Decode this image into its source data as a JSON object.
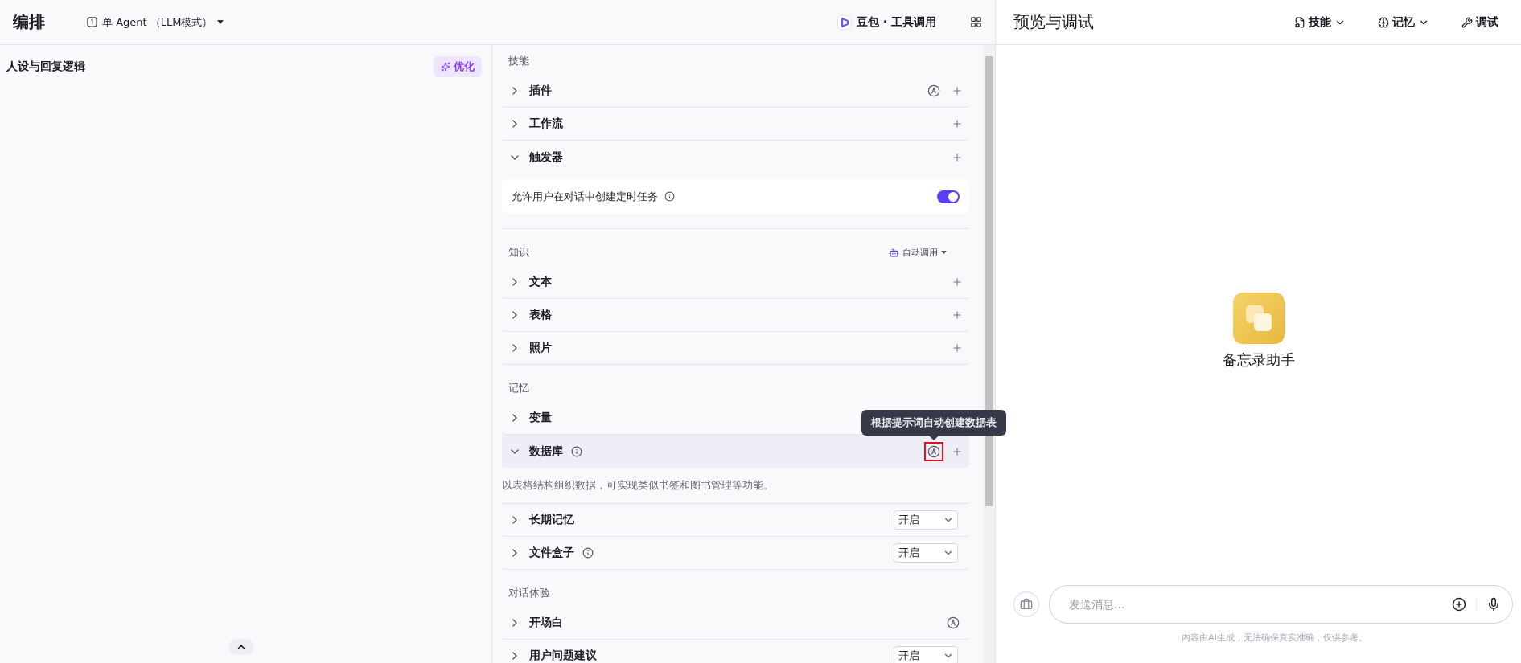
{
  "header": {
    "title": "编排",
    "mode": "单 Agent （LLM模式）",
    "model": "豆包 · 工具调用"
  },
  "persona": {
    "title": "人设与回复逻辑",
    "optimize": "优化"
  },
  "sections": [
    {
      "title": "技能",
      "items": [
        {
          "label": "插件",
          "kind": "add",
          "expanded": false,
          "auto": true
        },
        {
          "label": "工作流",
          "kind": "add",
          "expanded": false
        },
        {
          "label": "触发器",
          "kind": "add",
          "expanded": true,
          "setting": {
            "label": "允许用户在对话中创建定时任务",
            "on": true
          }
        }
      ]
    },
    {
      "title": "知识",
      "action": "自动调用",
      "items": [
        {
          "label": "文本",
          "kind": "add",
          "expanded": false
        },
        {
          "label": "表格",
          "kind": "add",
          "expanded": false
        },
        {
          "label": "照片",
          "kind": "add",
          "expanded": false
        }
      ]
    },
    {
      "title": "记忆",
      "items": [
        {
          "label": "变量",
          "kind": "none",
          "expanded": false
        },
        {
          "label": "数据库",
          "kind": "add",
          "expanded": true,
          "info": true,
          "auto": true,
          "hovered": true,
          "highlighted": true,
          "tooltip": "根据提示词自动创建数据表",
          "description": "以表格结构组织数据，可实现类似书签和图书管理等功能。"
        },
        {
          "label": "长期记忆",
          "kind": "select",
          "expanded": false,
          "value": "开启"
        },
        {
          "label": "文件盒子",
          "kind": "select",
          "expanded": false,
          "info": true,
          "value": "开启"
        }
      ]
    },
    {
      "title": "对话体验",
      "items": [
        {
          "label": "开场白",
          "kind": "none",
          "expanded": false,
          "auto": true
        },
        {
          "label": "用户问题建议",
          "kind": "select",
          "expanded": false,
          "value": "开启"
        }
      ]
    }
  ],
  "preview": {
    "title": "预览与调试",
    "actions": [
      {
        "label": "技能",
        "kind": "skills"
      },
      {
        "label": "记忆",
        "kind": "memory"
      },
      {
        "label": "调试",
        "kind": "debug"
      }
    ],
    "bot_name": "备忘录助手",
    "placeholder": "发送消息...",
    "footnote": "内容由AI生成，无法确保真实准确，仅供参考。"
  }
}
